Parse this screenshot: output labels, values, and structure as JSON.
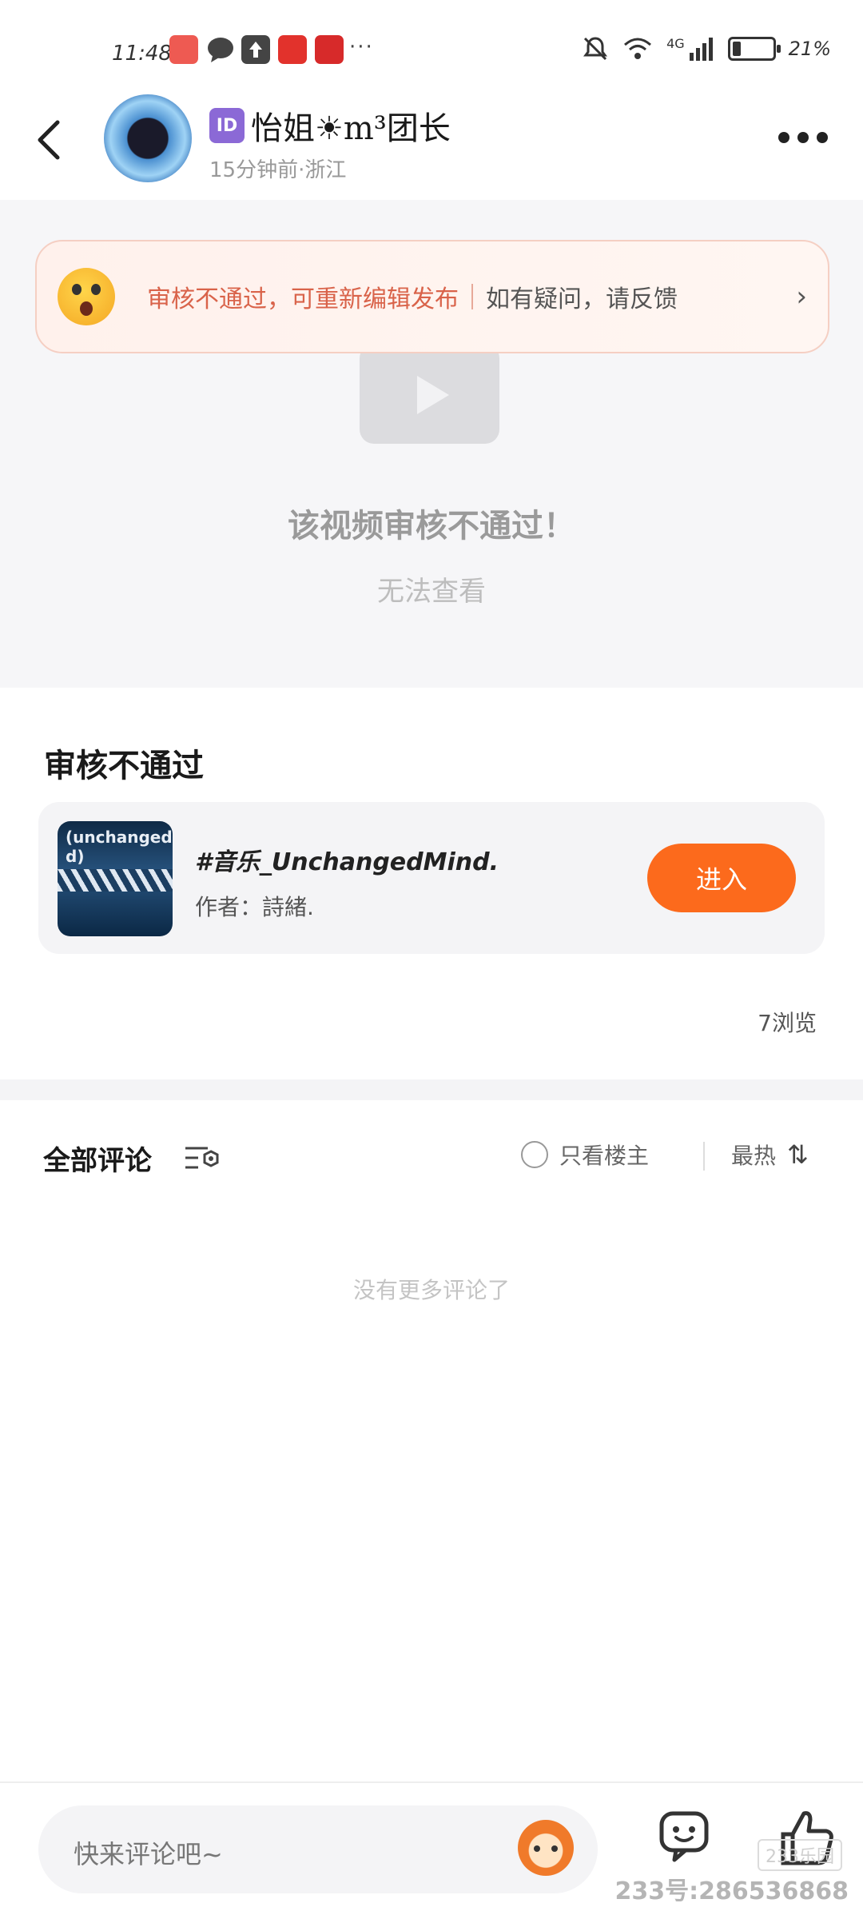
{
  "status_bar": {
    "time": "11:48",
    "battery": "21%",
    "battery_level": 0.21,
    "network": "4G",
    "apps": [
      {
        "icon": "huawei-app-icon",
        "color": "#ee5a52"
      },
      {
        "icon": "chat-bubble-icon",
        "color": "#444444"
      },
      {
        "icon": "upload-arrow-icon",
        "color": "#444444"
      },
      {
        "icon": "taobao-icon",
        "color": "#e2322c"
      },
      {
        "icon": "game-icon",
        "color": "#d72a2a"
      }
    ],
    "more": "···"
  },
  "header": {
    "badge": "ID",
    "username": "怡姐☀m³团长",
    "meta": "15分钟前·浙江"
  },
  "notice": {
    "main": "审核不通过，可重新编辑发布",
    "sub": "如有疑问，请反馈",
    "arrow": "›",
    "accent": "#d9634a"
  },
  "video": {
    "title": "该视频审核不通过！",
    "subtitle": "无法查看"
  },
  "post": {
    "title": "审核不通过",
    "views": "7浏览"
  },
  "music_card": {
    "cover_text": "(unchangedM d)",
    "title": "#音乐_UnchangedMind.",
    "author": "作者：詩緒.",
    "enter_label": "进入",
    "enter_color": "#fc6a1c"
  },
  "comments": {
    "title": "全部评论",
    "only_owner": "只看楼主",
    "sort": "最热",
    "sort_icon": "⇅",
    "empty": "没有更多评论了"
  },
  "bottom": {
    "placeholder": "快来评论吧~",
    "watermark": "233号:286536868",
    "watermark_badge": "233乐园"
  }
}
